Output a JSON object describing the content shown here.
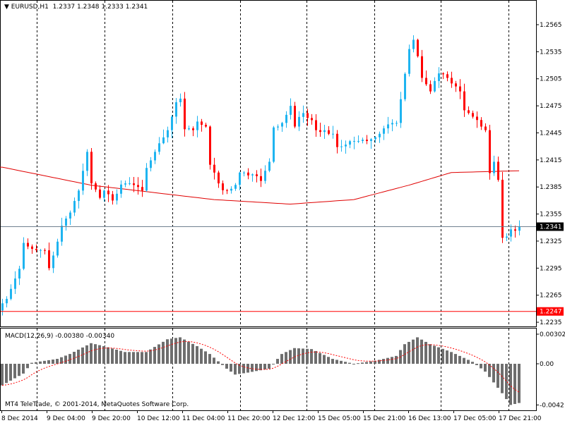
{
  "header": {
    "symbol": "EURUSD,H1",
    "open": "1.2337",
    "high": "1.2348",
    "low": "1.2333",
    "close": "1.2341"
  },
  "macd": {
    "label": "MACD(12,26,9)",
    "main": "-0.00380",
    "signal": "-0.00340"
  },
  "copyright": "MT4 TeleTrade, © 2001-2014, MetaQuotes Software Corp.",
  "colors": {
    "bull": "#1EB4F0",
    "bear": "#FF0000",
    "ma": "#E00000",
    "hist": "#6E6E6E",
    "signal": "#FF0000"
  },
  "chart_data": {
    "type": "candlestick",
    "price_axis": {
      "range": [
        1.2229,
        1.2592
      ],
      "ticks": [
        "1.2565",
        "1.2535",
        "1.2505",
        "1.2475",
        "1.2445",
        "1.2415",
        "1.2385",
        "1.2355",
        "1.2325",
        "1.2295",
        "1.2265",
        "1.2235"
      ]
    },
    "current_price": "1.2341",
    "marked_level": "1.2247",
    "time_labels": [
      "8 Dec 2014",
      "9 Dec 04:00",
      "9 Dec 20:00",
      "10 Dec 12:00",
      "11 Dec 04:00",
      "11 Dec 20:00",
      "12 Dec 12:00",
      "15 Dec 05:00",
      "15 Dec 21:00",
      "16 Dec 13:00",
      "17 Dec 05:00",
      "17 Dec 21:00"
    ],
    "bars": 123,
    "close_path": [
      [
        0,
        1.2256
      ],
      [
        2,
        1.2272
      ],
      [
        4,
        1.2295
      ],
      [
        5,
        1.2323
      ],
      [
        7,
        1.2315
      ],
      [
        9,
        1.2315
      ],
      [
        10,
        1.2311
      ],
      [
        11,
        1.2295
      ],
      [
        13,
        1.2323
      ],
      [
        14,
        1.2342
      ],
      [
        16,
        1.2358
      ],
      [
        18,
        1.2381
      ],
      [
        19,
        1.2405
      ],
      [
        20,
        1.2424
      ],
      [
        21,
        1.2389
      ],
      [
        23,
        1.2373
      ],
      [
        24,
        1.2381
      ],
      [
        26,
        1.237
      ],
      [
        28,
        1.2385
      ],
      [
        29,
        1.2389
      ],
      [
        31,
        1.2389
      ],
      [
        33,
        1.2381
      ],
      [
        34,
        1.2405
      ],
      [
        36,
        1.2424
      ],
      [
        38,
        1.244
      ],
      [
        39,
        1.2448
      ],
      [
        41,
        1.2479
      ],
      [
        42,
        1.2483
      ],
      [
        43,
        1.2452
      ],
      [
        45,
        1.2448
      ],
      [
        46,
        1.2456
      ],
      [
        48,
        1.2452
      ],
      [
        49,
        1.2413
      ],
      [
        51,
        1.2389
      ],
      [
        53,
        1.2381
      ],
      [
        55,
        1.2385
      ],
      [
        56,
        1.2401
      ],
      [
        58,
        1.2401
      ],
      [
        60,
        1.2397
      ],
      [
        61,
        1.2393
      ],
      [
        63,
        1.2413
      ],
      [
        64,
        1.2448
      ],
      [
        66,
        1.2456
      ],
      [
        68,
        1.2475
      ],
      [
        69,
        1.2452
      ],
      [
        71,
        1.2467
      ],
      [
        73,
        1.2456
      ],
      [
        74,
        1.2448
      ],
      [
        76,
        1.2444
      ],
      [
        78,
        1.2444
      ],
      [
        79,
        1.2428
      ],
      [
        81,
        1.2432
      ],
      [
        83,
        1.2436
      ],
      [
        84,
        1.2436
      ],
      [
        86,
        1.2436
      ],
      [
        88,
        1.244
      ],
      [
        89,
        1.2444
      ],
      [
        91,
        1.2456
      ],
      [
        93,
        1.2456
      ],
      [
        94,
        1.2483
      ],
      [
        96,
        1.2538
      ],
      [
        97,
        1.2549
      ],
      [
        98,
        1.253
      ],
      [
        99,
        1.2506
      ],
      [
        101,
        1.2491
      ],
      [
        103,
        1.2514
      ],
      [
        104,
        1.251
      ],
      [
        106,
        1.2502
      ],
      [
        108,
        1.2491
      ],
      [
        109,
        1.2471
      ],
      [
        111,
        1.2463
      ],
      [
        113,
        1.2452
      ],
      [
        114,
        1.2448
      ],
      [
        115,
        1.2397
      ],
      [
        116,
        1.2413
      ],
      [
        117,
        1.2393
      ],
      [
        118,
        1.2327
      ],
      [
        119,
        1.233
      ],
      [
        120,
        1.2338
      ],
      [
        122,
        1.2341
      ]
    ],
    "ma_path": [
      [
        0,
        1.2407
      ],
      [
        21,
        1.2387
      ],
      [
        50,
        1.2371
      ],
      [
        68,
        1.2366
      ],
      [
        83,
        1.2371
      ],
      [
        96,
        1.2387
      ],
      [
        106,
        1.2401
      ],
      [
        122,
        1.2403
      ]
    ],
    "macd_axis": {
      "range": [
        -0.0044,
        0.0033
      ],
      "ticks": [
        "0.00302",
        "0.00",
        "-0.0042"
      ]
    },
    "macd_hist_path": [
      [
        0,
        -0.0022
      ],
      [
        5,
        -0.001
      ],
      [
        7,
        0.0001
      ],
      [
        10,
        0.0003
      ],
      [
        13,
        0.0005
      ],
      [
        16,
        0.001
      ],
      [
        21,
        0.0021
      ],
      [
        24,
        0.0018
      ],
      [
        29,
        0.0012
      ],
      [
        34,
        0.0012
      ],
      [
        39,
        0.0025
      ],
      [
        42,
        0.0027
      ],
      [
        46,
        0.0018
      ],
      [
        49,
        0.001
      ],
      [
        53,
        -0.0005
      ],
      [
        55,
        -0.0011
      ],
      [
        58,
        -0.0009
      ],
      [
        63,
        -0.0005
      ],
      [
        66,
        0.001
      ],
      [
        69,
        0.0016
      ],
      [
        73,
        0.0015
      ],
      [
        78,
        0.0005
      ],
      [
        83,
        0.0
      ],
      [
        88,
        0.0003
      ],
      [
        93,
        0.0008
      ],
      [
        95,
        0.002
      ],
      [
        98,
        0.0027
      ],
      [
        101,
        0.002
      ],
      [
        106,
        0.0012
      ],
      [
        111,
        0.0002
      ],
      [
        114,
        -0.0008
      ],
      [
        118,
        -0.003
      ],
      [
        120,
        -0.0042
      ],
      [
        122,
        -0.004
      ]
    ]
  }
}
